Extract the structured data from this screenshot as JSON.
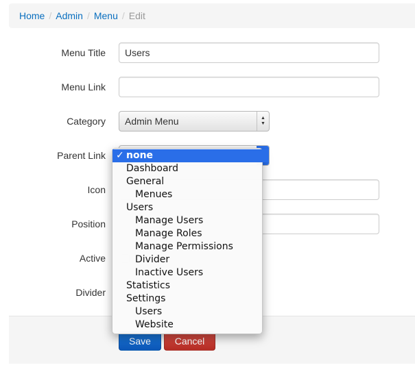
{
  "breadcrumb": {
    "items": [
      {
        "label": "Home"
      },
      {
        "label": "Admin"
      },
      {
        "label": "Menu"
      }
    ],
    "current": "Edit",
    "separator": "/"
  },
  "form": {
    "menu_title": {
      "label": "Menu Title",
      "value": "Users"
    },
    "menu_link": {
      "label": "Menu Link",
      "value": ""
    },
    "category": {
      "label": "Category",
      "value": "Admin Menu"
    },
    "parent_link": {
      "label": "Parent Link",
      "value": "none"
    },
    "icon": {
      "label": "Icon",
      "value": ""
    },
    "position": {
      "label": "Position",
      "value": ""
    },
    "active": {
      "label": "Active",
      "checked": true
    },
    "divider": {
      "label": "Divider",
      "checked": false
    }
  },
  "dropdown": {
    "check_mark": "✓",
    "options": [
      {
        "label": "none",
        "level": 1,
        "selected": true
      },
      {
        "label": "Dashboard",
        "level": 1
      },
      {
        "label": "General",
        "level": 1
      },
      {
        "label": "Menues",
        "level": 2
      },
      {
        "label": "Users",
        "level": 1
      },
      {
        "label": "Manage Users",
        "level": 2
      },
      {
        "label": "Manage Roles",
        "level": 2
      },
      {
        "label": "Manage Permissions",
        "level": 2
      },
      {
        "label": "Divider",
        "level": 2
      },
      {
        "label": "Inactive Users",
        "level": 2
      },
      {
        "label": "Statistics",
        "level": 1
      },
      {
        "label": "Settings",
        "level": 1
      },
      {
        "label": "Users",
        "level": 2
      },
      {
        "label": "Website",
        "level": 2
      }
    ]
  },
  "buttons": {
    "save": "Save",
    "cancel": "Cancel"
  },
  "colors": {
    "link": "#0a6fbf",
    "save": "#0c56b6",
    "cancel": "#b42c24",
    "highlight": "#2a6ee8"
  }
}
